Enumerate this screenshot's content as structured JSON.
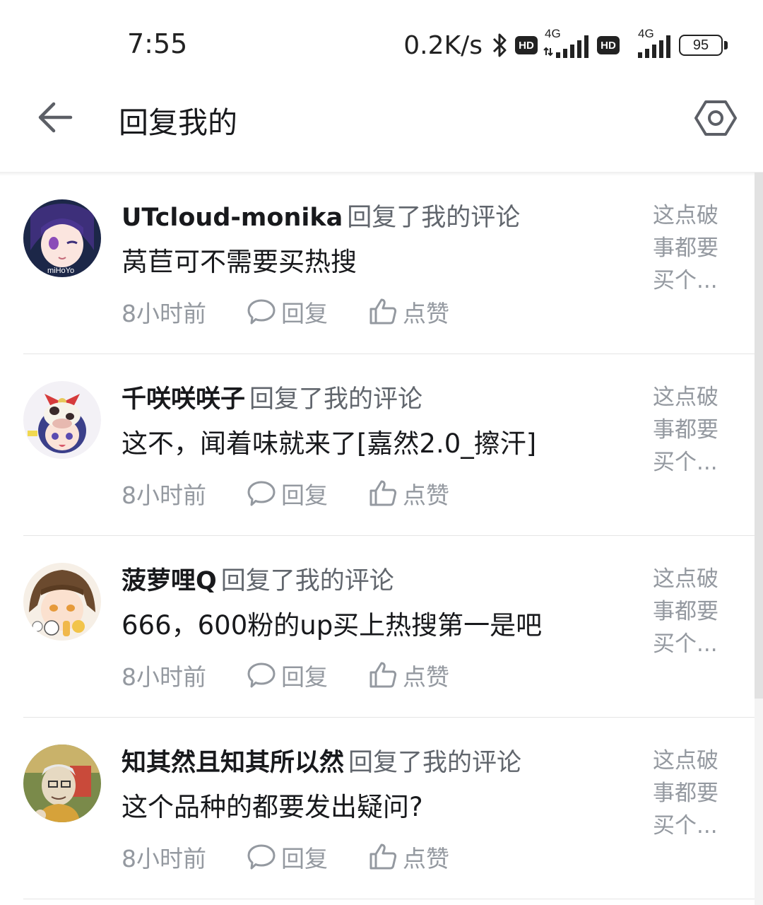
{
  "status_bar": {
    "time": "7:55",
    "net_speed": "0.2K/s",
    "hd_label": "HD",
    "network_type": "4G",
    "battery": "95"
  },
  "header": {
    "title": "回复我的"
  },
  "replies": [
    {
      "user": "UTcloud-monika",
      "action": "回复了我的评论",
      "content": "莴苣可不需要买热搜",
      "time": "8小时前",
      "reply_label": "回复",
      "like_label": "点赞",
      "source_preview": "这点破事都要买个...",
      "avatar_watermark": "miHoYo"
    },
    {
      "user": "千咲咲咲子",
      "action": "回复了我的评论",
      "content": "这不，闻着味就来了[嘉然2.0_擦汗]",
      "time": "8小时前",
      "reply_label": "回复",
      "like_label": "点赞",
      "source_preview": "这点破事都要买个..."
    },
    {
      "user": "菠萝哩Q",
      "action": "回复了我的评论",
      "content": "666，600粉的up买上热搜第一是吧",
      "time": "8小时前",
      "reply_label": "回复",
      "like_label": "点赞",
      "source_preview": "这点破事都要买个..."
    },
    {
      "user": "知其然且知其所以然",
      "action": "回复了我的评论",
      "content": "这个品种的都要发出疑问?",
      "time": "8小时前",
      "reply_label": "回复",
      "like_label": "点赞",
      "source_preview": "这点破事都要买个..."
    }
  ],
  "icons": {
    "back": "arrow-left-icon",
    "settings": "hexagon-settings-icon",
    "reply": "chat-bubble-icon",
    "like": "thumbs-up-icon"
  }
}
